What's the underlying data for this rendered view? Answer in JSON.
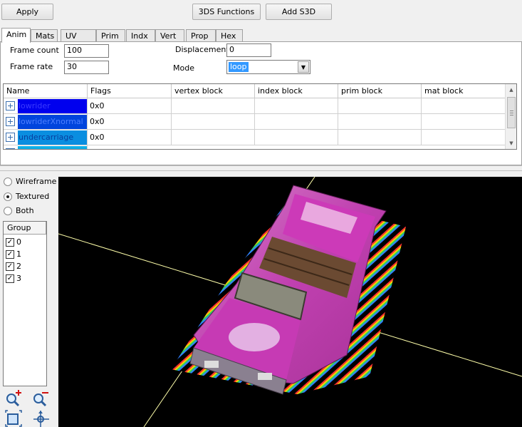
{
  "toolbar": {
    "apply_label": "Apply",
    "functions_label": "3DS Functions",
    "add_s3d_label": "Add S3D"
  },
  "tabs": [
    {
      "label": "Anim",
      "active": true
    },
    {
      "label": "Mats"
    },
    {
      "label": "UV map"
    },
    {
      "label": "Prim"
    },
    {
      "label": "Indx"
    },
    {
      "label": "Vert"
    },
    {
      "label": "Prop"
    },
    {
      "label": "Hex"
    }
  ],
  "anim": {
    "frame_count_label": "Frame count",
    "frame_count_value": "100",
    "frame_rate_label": "Frame rate",
    "frame_rate_value": "30",
    "displacement_label": "Displacement",
    "displacement_value": "0",
    "mode_label": "Mode",
    "mode_value": "loop"
  },
  "table": {
    "columns": [
      "Name",
      "Flags",
      "vertex block",
      "index block",
      "prim block",
      "mat block"
    ],
    "rows": [
      {
        "name": "lowrider",
        "flags": "0x0",
        "name_bg": "#0000ee"
      },
      {
        "name": "lowriderXnormal",
        "flags": "0x0",
        "name_bg": "#0044dd"
      },
      {
        "name": "undercarriage",
        "flags": "0x0",
        "name_bg": "#0a8ee0"
      }
    ]
  },
  "view_mode": {
    "options": [
      "Wireframe",
      "Textured",
      "Both"
    ],
    "selected": "Textured"
  },
  "groups": {
    "header": "Group",
    "items": [
      {
        "label": "0",
        "checked": true
      },
      {
        "label": "1",
        "checked": true
      },
      {
        "label": "2",
        "checked": true
      },
      {
        "label": "3",
        "checked": true
      }
    ]
  },
  "icons": {
    "zoom_in": "zoom-in-icon",
    "zoom_out": "zoom-out-icon",
    "fit": "fit-view-icon",
    "axes": "axes-icon"
  },
  "colors": {
    "selection": "#3399ff",
    "car_pink": "#cc33bb",
    "axis_line": "#ffff99"
  }
}
